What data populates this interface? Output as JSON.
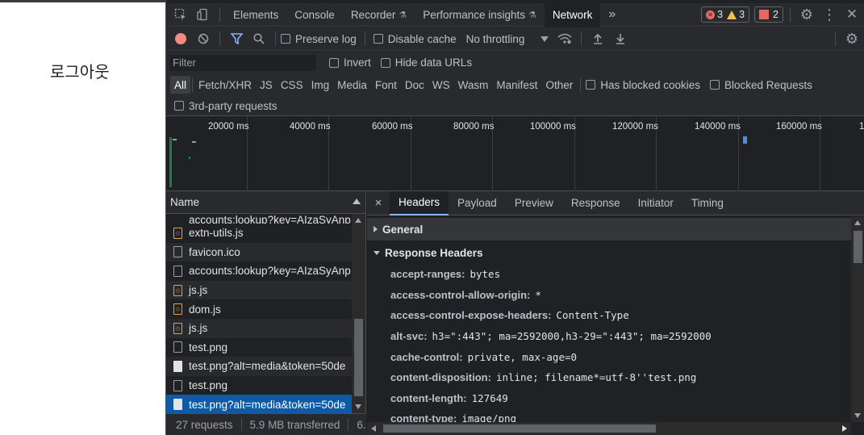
{
  "page": {
    "logout_label": "로그아웃"
  },
  "tabs": {
    "elements": "Elements",
    "console": "Console",
    "recorder": "Recorder",
    "performance_insights": "Performance insights",
    "network": "Network",
    "more": "»"
  },
  "badges": {
    "errors": "3",
    "warnings": "3",
    "issues": "2"
  },
  "toolbar": {
    "preserve_log": "Preserve log",
    "disable_cache": "Disable cache",
    "throttling": "No throttling"
  },
  "filter": {
    "placeholder": "Filter",
    "invert": "Invert",
    "hide_data_urls": "Hide data URLs"
  },
  "types": [
    "All",
    "Fetch/XHR",
    "JS",
    "CSS",
    "Img",
    "Media",
    "Font",
    "Doc",
    "WS",
    "Wasm",
    "Manifest",
    "Other"
  ],
  "type_checks": {
    "has_blocked_cookies": "Has blocked cookies",
    "blocked_requests": "Blocked Requests",
    "third_party": "3rd-party requests"
  },
  "overview": {
    "ticks": [
      "20000 ms",
      "40000 ms",
      "60000 ms",
      "80000 ms",
      "100000 ms",
      "120000 ms",
      "140000 ms",
      "160000 ms",
      "1"
    ]
  },
  "requests": {
    "column_name": "Name",
    "partial_row": "accounts:lookup?key=AIzaSyAnp",
    "rows": [
      {
        "name": "extn-utils.js",
        "type": "script"
      },
      {
        "name": "favicon.ico",
        "type": "doc"
      },
      {
        "name": "accounts:lookup?key=AIzaSyAnp",
        "type": "doc"
      },
      {
        "name": "js.js",
        "type": "script"
      },
      {
        "name": "dom.js",
        "type": "script"
      },
      {
        "name": "js.js",
        "type": "script"
      },
      {
        "name": "test.png",
        "type": "doc"
      },
      {
        "name": "test.png?alt=media&token=50de",
        "type": "image"
      },
      {
        "name": "test.png",
        "type": "doc"
      },
      {
        "name": "test.png?alt=media&token=50de",
        "type": "image",
        "selected": true
      }
    ]
  },
  "status": {
    "requests": "27 requests",
    "transferred": "5.9 MB transferred",
    "more": "6."
  },
  "detail": {
    "close": "×",
    "tabs": [
      "Headers",
      "Payload",
      "Preview",
      "Response",
      "Initiator",
      "Timing"
    ],
    "general": "General",
    "response_headers": "Response Headers",
    "headers": [
      {
        "key": "accept-ranges:",
        "value": "bytes"
      },
      {
        "key": "access-control-allow-origin:",
        "value": "*"
      },
      {
        "key": "access-control-expose-headers:",
        "value": "Content-Type"
      },
      {
        "key": "alt-svc:",
        "value": "h3=\":443\"; ma=2592000,h3-29=\":443\"; ma=2592000"
      },
      {
        "key": "cache-control:",
        "value": "private, max-age=0"
      },
      {
        "key": "content-disposition:",
        "value": "inline; filename*=utf-8''test.png"
      },
      {
        "key": "content-length:",
        "value": "127649"
      },
      {
        "key": "content-type:",
        "value": "image/png"
      }
    ]
  },
  "colors": {
    "accent": "#8ab4f8",
    "selected_row": "#0e5aa7",
    "record": "#f28b82",
    "error": "#e46962",
    "warning": "#f3c147"
  }
}
